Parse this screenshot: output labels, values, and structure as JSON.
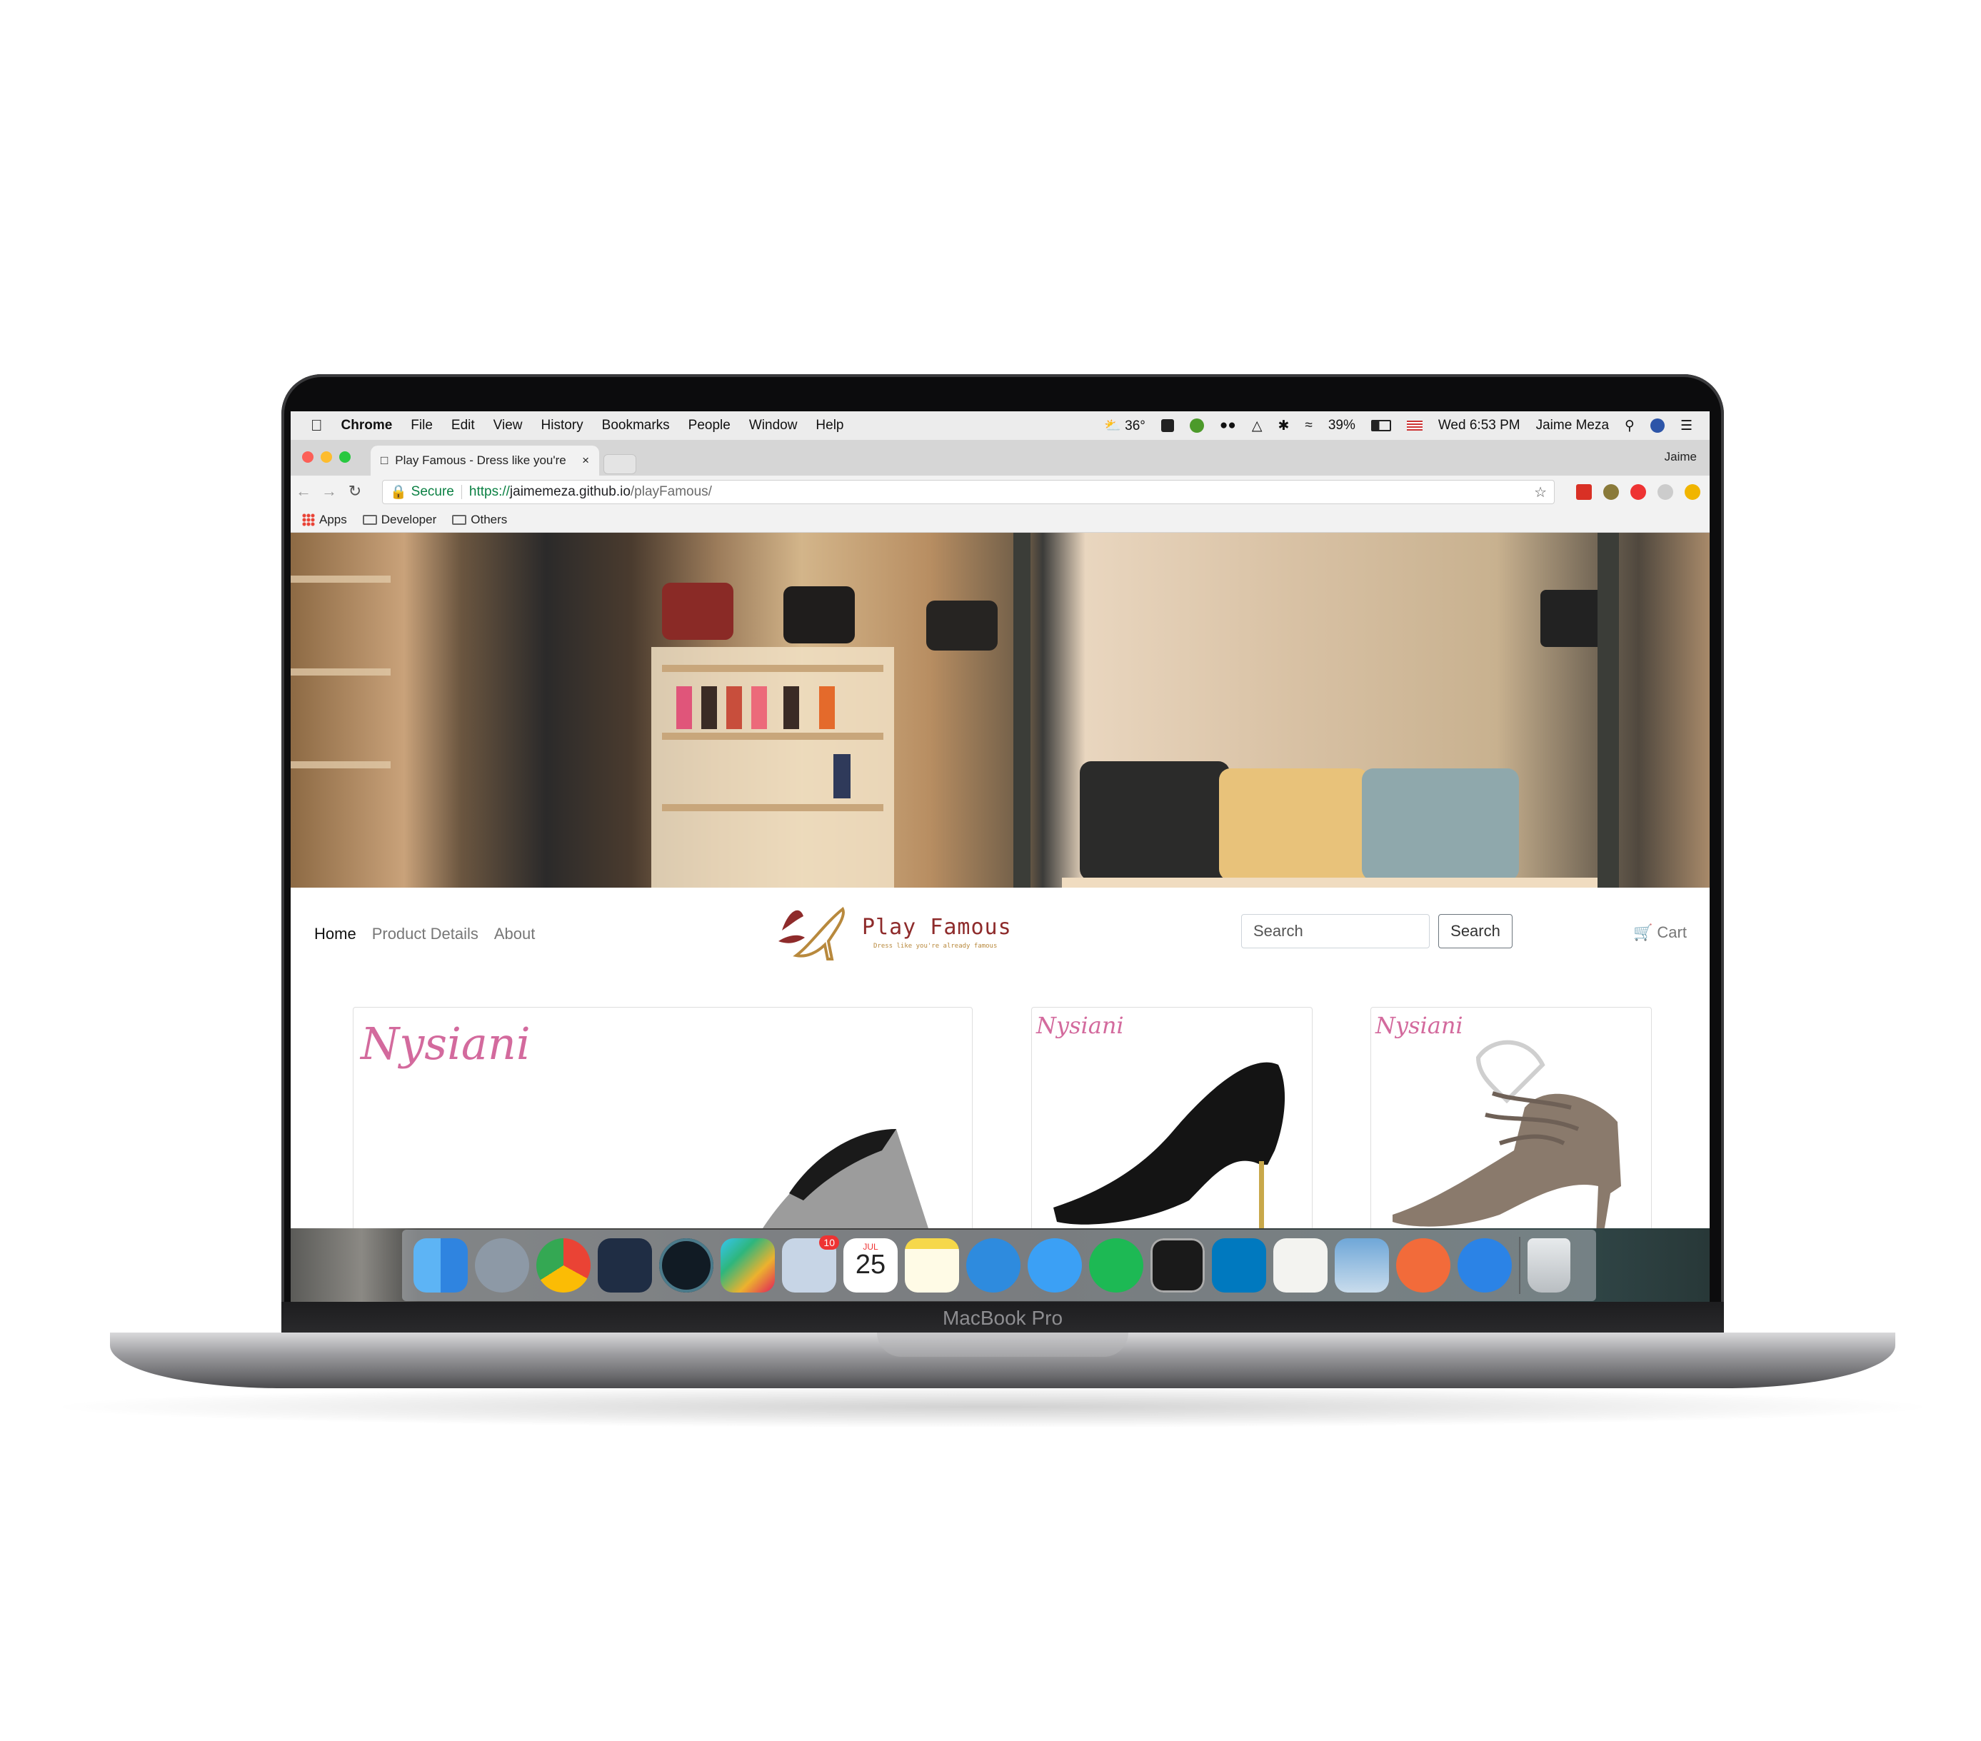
{
  "menubar": {
    "app": "Chrome",
    "items": [
      "File",
      "Edit",
      "View",
      "History",
      "Bookmarks",
      "People",
      "Window",
      "Help"
    ],
    "weather": "36°",
    "battery": "39%",
    "clock": "Wed 6:53 PM",
    "user": "Jaime Meza"
  },
  "browser": {
    "tab_title": "Play Famous - Dress like you're",
    "profile_name": "Jaime",
    "secure_label": "Secure",
    "url_scheme": "https://",
    "url_host": "jaimemeza.github.io",
    "url_path": "/playFamous/",
    "bookmarks": [
      "Apps",
      "Developer",
      "Others"
    ]
  },
  "site": {
    "nav": [
      "Home",
      "Product Details",
      "About"
    ],
    "brand_name": "Play Famous",
    "brand_tagline": "Dress like you're already famous",
    "search_placeholder": "Search",
    "search_button": "Search",
    "cart_label": "Cart",
    "product_brand": "Nysiani"
  },
  "dock": {
    "calendar_month": "JUL",
    "calendar_day": "25",
    "mail_badge": "10"
  },
  "device": {
    "label": "MacBook Pro"
  },
  "colors": {
    "brand": "#8e2b2b",
    "brand_gold": "#b8893d",
    "secure_green": "#0b8043"
  }
}
